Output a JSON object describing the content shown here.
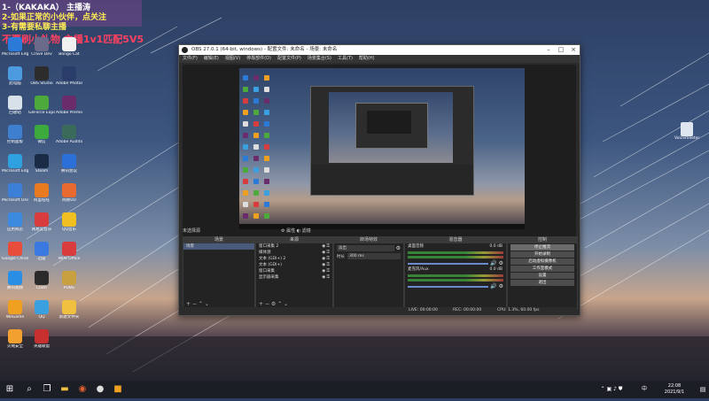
{
  "overlay": {
    "line1": "1-（KAKAKA）  主播涛",
    "line2": "2-如果正常的小伙伴，点关注",
    "line3": "3-有需要私聊主播",
    "line4": "不要刷小礼物    主播1v1匹配5V5"
  },
  "desktop": {
    "col1": [
      {
        "label": "Microsoft Edge",
        "color": "#2b7ad8"
      },
      {
        "label": "此电脑",
        "color": "#4c9ae0"
      },
      {
        "label": "回收站",
        "color": "#d8e0ea"
      },
      {
        "label": "控制面板",
        "color": "#3f7fd0"
      },
      {
        "label": "Microsoft Edge",
        "color": "#2fa1e0"
      },
      {
        "label": "Microsoft OneDrive",
        "color": "#3c7fd8"
      },
      {
        "label": "应用商店",
        "color": "#3a8ae0"
      },
      {
        "label": "Google Chrome",
        "color": "#e84d3c"
      },
      {
        "label": "腾讯视频",
        "color": "#2a8fe4"
      },
      {
        "label": "WeGame",
        "color": "#f0a020"
      },
      {
        "label": "火绒安全",
        "color": "#f2a030"
      }
    ],
    "col2": [
      {
        "label": "Crave Dev",
        "color": "#6a6a8a"
      },
      {
        "label": "OBS Studio",
        "color": "#2c2c2c"
      },
      {
        "label": "GeForce Experience",
        "color": "#4caa3c"
      },
      {
        "label": "微信",
        "color": "#3caa3c"
      },
      {
        "label": "Steam",
        "color": "#1a2b45"
      },
      {
        "label": "阿里旺旺",
        "color": "#ea7a20"
      },
      {
        "label": "网易云音乐",
        "color": "#d83c3c"
      },
      {
        "label": "迅雷",
        "color": "#3a7ae0"
      },
      {
        "label": "Clash",
        "color": "#2a2a2a"
      },
      {
        "label": "QQ",
        "color": "#3aa0e0"
      },
      {
        "label": "英雄联盟",
        "color": "#c83030"
      }
    ],
    "col3": [
      {
        "label": "Bongo Cat",
        "color": "#f0f0f0"
      },
      {
        "label": "Adobe Photoshop",
        "color": "#2a3c6a"
      },
      {
        "label": "Adobe Premiere",
        "color": "#6a2c6a"
      },
      {
        "label": "Adobe Audition",
        "color": "#3a6a5a"
      },
      {
        "label": "腾讯会议",
        "color": "#2a70d8"
      },
      {
        "label": "网易UU",
        "color": "#e86a30"
      },
      {
        "label": "QQ音乐",
        "color": "#f0c020"
      },
      {
        "label": "WPS Office",
        "color": "#d83c3c"
      },
      {
        "label": "PUBG",
        "color": "#c8a040"
      },
      {
        "label": "新建文件夹",
        "color": "#f0c040"
      }
    ],
    "right_icon": {
      "label": "Voicemeeter",
      "color": "#e0e6ef"
    }
  },
  "obs": {
    "title": "OBS 27.0.1 (64-bit, windows) - 配置文件: 未命名 - 场景: 未命名",
    "menu": [
      "文件(F)",
      "编辑(E)",
      "视图(V)",
      "停靠部件(D)",
      "配置文件(P)",
      "场景集合(S)",
      "工具(T)",
      "帮助(H)"
    ],
    "scene_selected_label": "未选择源",
    "props_label": "属性",
    "filters_label": "滤镜",
    "docks": {
      "scenes": {
        "header": "场景",
        "items": [
          "场景"
        ]
      },
      "sources": {
        "header": "来源",
        "items": [
          "窗口采集 2",
          "媒体源",
          "文本 (GDI+) 2",
          "文本 (GDI+)",
          "窗口采集",
          "显示器采集"
        ]
      },
      "transitions": {
        "header": "转场特效",
        "type": "淡出",
        "duration_label": "时长",
        "duration": "300 ms"
      },
      "mixer": {
        "header": "混音器",
        "ch1": "桌面音频",
        "ch1_db": "0.0 dB",
        "ch2": "麦克风/Aux",
        "ch2_db": "0.0 dB"
      },
      "controls": {
        "header": "控制",
        "buttons": [
          "停止推流",
          "开始录制",
          "启动虚拟摄像机",
          "工作室模式",
          "设置",
          "退出"
        ]
      }
    },
    "status": {
      "live": "LIVE: 00:00:00",
      "rec": "REC: 00:00:00",
      "cpu": "CPU: 1.3%, 60.00 fps"
    }
  },
  "taskbar": {
    "time": "22:08",
    "date": "2021/9/1",
    "lang": "中"
  }
}
